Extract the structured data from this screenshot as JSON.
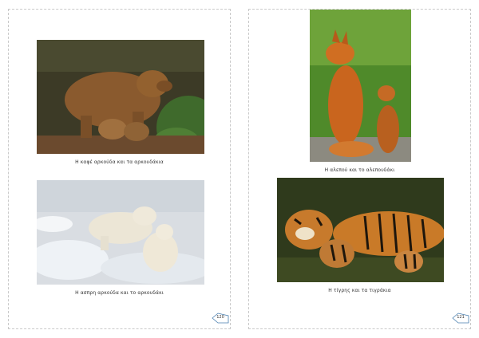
{
  "pages": [
    {
      "number": "120",
      "photos": [
        {
          "subject": "brown bear with cubs",
          "caption": "Η καφέ αρκούδα και τα αρκουδάκια"
        },
        {
          "subject": "polar bear with cub",
          "caption": "Η ασπρη αρκούδα και το αρκουδάκι"
        }
      ]
    },
    {
      "number": "121",
      "photos": [
        {
          "subject": "red fox with kit",
          "caption": "Η αλεπού και το αλεπουδάκι"
        },
        {
          "subject": "tiger with cubs",
          "caption": "Η τίγρης και τα τιγράκια"
        }
      ]
    }
  ]
}
